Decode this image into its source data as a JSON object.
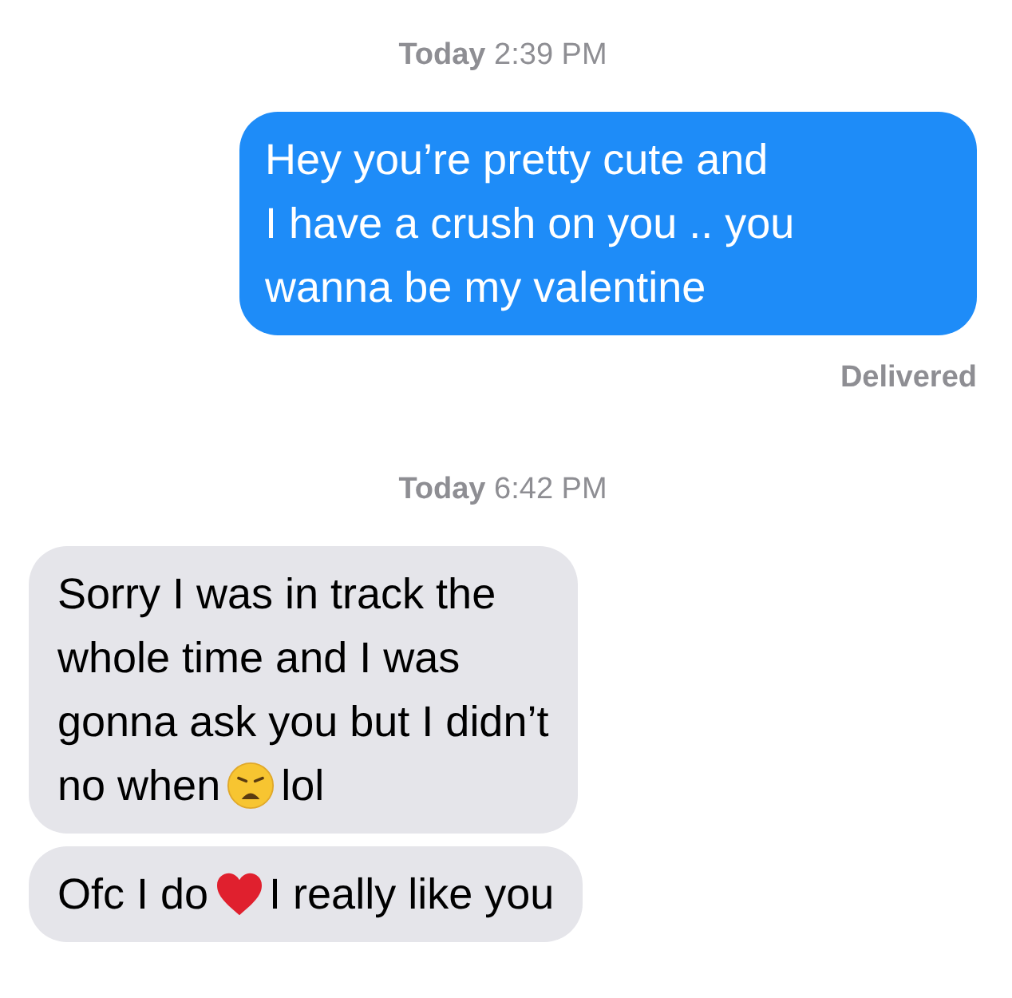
{
  "thread": [
    {
      "kind": "timestamp",
      "text": "**Today** 2:39 PM"
    },
    {
      "kind": "sent",
      "lines": [
        [
          {
            "kind": "text",
            "text": "Hey you’re pretty cute and"
          }
        ],
        [
          {
            "kind": "text",
            "text": "I have a crush on you .. you"
          }
        ],
        [
          {
            "kind": "text",
            "text": "wanna be my valentine"
          }
        ]
      ]
    },
    {
      "kind": "status",
      "text": "Delivered"
    },
    {
      "kind": "timestamp",
      "text": "**Today** 6:42 PM"
    },
    {
      "kind": "received",
      "lines": [
        [
          {
            "kind": "text",
            "text": "Sorry I was in track the"
          }
        ],
        [
          {
            "kind": "text",
            "text": "whole time and I was"
          }
        ],
        [
          {
            "kind": "text",
            "text": "gonna ask you but I didn’t"
          }
        ],
        [
          {
            "kind": "text",
            "text": "no when"
          },
          {
            "kind": "face"
          },
          {
            "kind": "text",
            "text": "lol"
          }
        ]
      ]
    },
    {
      "kind": "received",
      "lines": [
        [
          {
            "kind": "text",
            "text": "Ofc I do"
          },
          {
            "kind": "heart"
          },
          {
            "kind": "text",
            "text": "I really like you"
          }
        ]
      ]
    }
  ]
}
